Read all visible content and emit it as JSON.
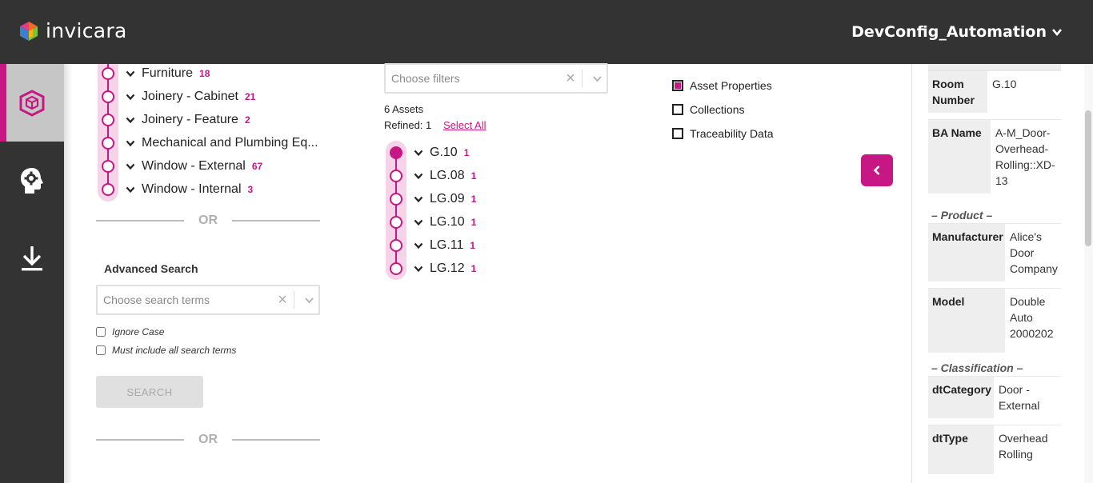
{
  "header": {
    "brand": "invicara",
    "project": "DevConfig_Automation"
  },
  "nav": [
    "cube-icon",
    "gear-head-icon",
    "download-icon"
  ],
  "tree": [
    {
      "label": "Furniture",
      "count": "18"
    },
    {
      "label": "Joinery - Cabinet",
      "count": "21"
    },
    {
      "label": "Joinery - Feature",
      "count": "2"
    },
    {
      "label": "Mechanical and Plumbing Eq...",
      "count": ""
    },
    {
      "label": "Window - External",
      "count": "67"
    },
    {
      "label": "Window - Internal",
      "count": "3"
    }
  ],
  "or_label": "OR",
  "advanced": {
    "title": "Advanced Search",
    "placeholder": "Choose search terms",
    "ignore_case": "Ignore Case",
    "must_include": "Must include all search terms",
    "search_button": "SEARCH"
  },
  "filters": {
    "placeholder": "Choose filters",
    "assets_count": "6 Assets",
    "refined": "Refined: 1",
    "select_all": "Select All"
  },
  "assets": [
    {
      "label": "G.10",
      "count": "1",
      "selected": true
    },
    {
      "label": "LG.08",
      "count": "1",
      "selected": false
    },
    {
      "label": "LG.09",
      "count": "1",
      "selected": false
    },
    {
      "label": "LG.10",
      "count": "1",
      "selected": false
    },
    {
      "label": "LG.11",
      "count": "1",
      "selected": false
    },
    {
      "label": "LG.12",
      "count": "1",
      "selected": false
    }
  ],
  "options": [
    {
      "label": "Asset Properties",
      "checked": true
    },
    {
      "label": "Collections",
      "checked": false
    },
    {
      "label": "Traceability Data",
      "checked": false
    }
  ],
  "properties": {
    "room_number": {
      "key": "Room Number",
      "value": "G.10"
    },
    "ba_name": {
      "key": "BA Name",
      "value": "A-M_Door-Overhead-Rolling::XD-13"
    },
    "product_heading": "– Product –",
    "manufacturer": {
      "key": "Manufacturer",
      "value": "Alice's Door Company"
    },
    "model": {
      "key": "Model",
      "value": "Double Auto 2000202"
    },
    "classification_heading": "– Classification –",
    "dt_category": {
      "key": "dtCategory",
      "value": "Door - External"
    },
    "dt_type": {
      "key": "dtType",
      "value": "Overhead Rolling"
    }
  },
  "colors": {
    "accent": "#c71784",
    "header": "#333333",
    "accent_light": "#f6d3e6"
  }
}
